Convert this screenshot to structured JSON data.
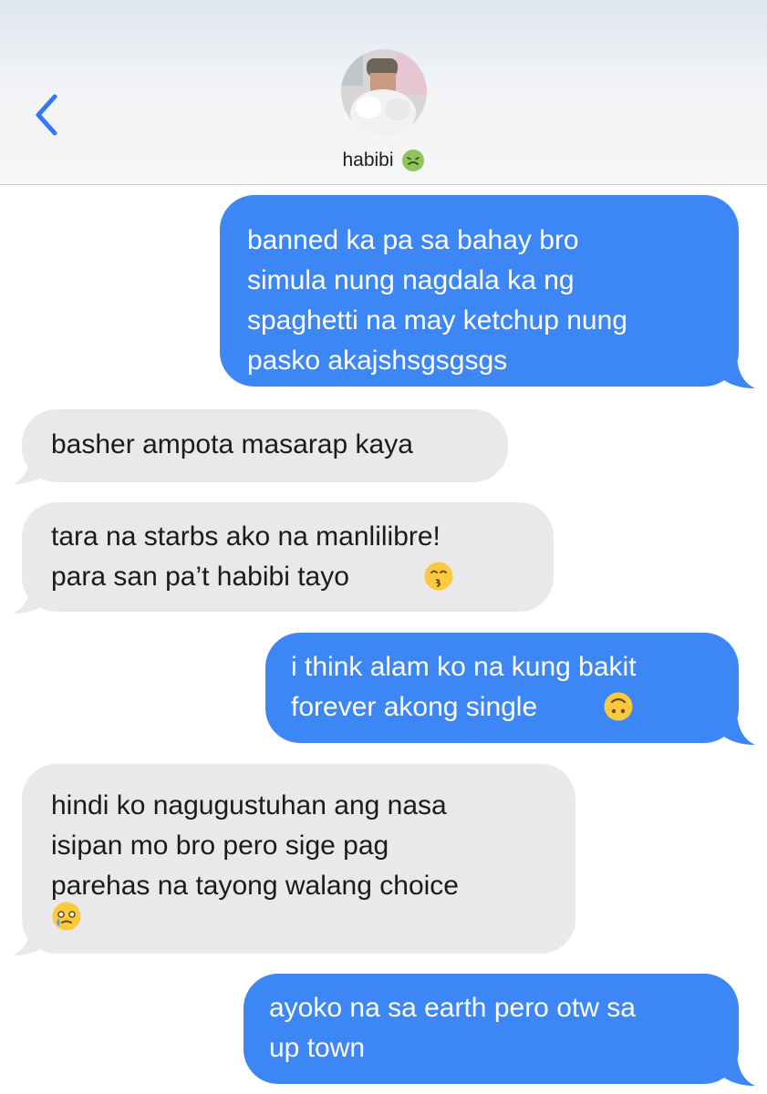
{
  "header": {
    "back_icon": "chevron-left-icon",
    "contact_name": "habibi",
    "contact_emoji": "nauseated-face-emoji",
    "avatar": "contact-photo"
  },
  "colors": {
    "sent_bubble": "#3d86f5",
    "received_bubble": "#e9e9eb",
    "accent": "#3478f6"
  },
  "messages": [
    {
      "direction": "sent",
      "text": "banned ka pa sa bahay bro\nsimula nung nagdala ka ng\nspaghetti na may ketchup nung\npasko akajshsgsgsgs"
    },
    {
      "direction": "received",
      "text": "basher ampota masarap kaya"
    },
    {
      "direction": "received",
      "text": "tara na starbs ako na manlilibre!\npara san pa’t habibi tayo",
      "emoji": "kissing-face-emoji"
    },
    {
      "direction": "sent",
      "text": "i think alam ko na kung bakit\nforever akong single",
      "emoji": "upside-down-face-emoji"
    },
    {
      "direction": "received",
      "text": "hindi ko nagugustuhan ang nasa\nisipan mo bro pero sige pag\nparehas na tayong walang choice",
      "emoji": "face-holding-back-tears-emoji"
    },
    {
      "direction": "sent",
      "text": "ayoko na sa earth pero otw sa\nup town"
    }
  ]
}
